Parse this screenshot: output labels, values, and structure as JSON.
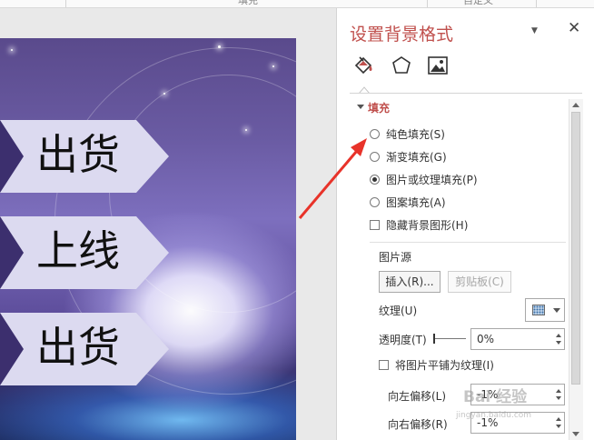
{
  "ribbon": {
    "left_text": "",
    "mid_text": "填充",
    "right_text": "自定义"
  },
  "slide": {
    "banners": [
      "出货",
      "上线",
      "出货"
    ]
  },
  "pane": {
    "title": "设置背景格式",
    "dropdown_glyph": "▼",
    "close_glyph": "✕",
    "tabs": [
      {
        "name": "fill-tab",
        "icon": "paint-bucket-icon",
        "active": true
      },
      {
        "name": "effects-tab",
        "icon": "pentagon-icon",
        "active": false
      },
      {
        "name": "picture-tab",
        "icon": "picture-icon",
        "active": false
      }
    ],
    "section": {
      "title": "填充",
      "expanded": true
    },
    "fill_options": [
      {
        "label": "纯色填充(S)",
        "checked": false
      },
      {
        "label": "渐变填充(G)",
        "checked": false
      },
      {
        "label": "图片或纹理填充(P)",
        "checked": true
      },
      {
        "label": "图案填充(A)",
        "checked": false
      }
    ],
    "hide_bg_graphics": {
      "label": "隐藏背景图形(H)",
      "checked": false
    },
    "picture_source": {
      "label": "图片源",
      "insert_label": "插入(R)...",
      "clipboard_label": "剪贴板(C)"
    },
    "texture": {
      "label": "纹理(U)"
    },
    "transparency": {
      "label": "透明度(T)",
      "value": "0%",
      "level": 0
    },
    "tile": {
      "label": "将图片平铺为纹理(I)",
      "checked": false
    },
    "offset_left": {
      "label": "向左偏移(L)",
      "value": "-1%"
    },
    "offset_right": {
      "label": "向右偏移(R)",
      "value": "-1%"
    }
  },
  "watermark": {
    "text": "Bai 经验",
    "sub": "jingyan.baidu.com"
  },
  "colors": {
    "accent": "#c0504d",
    "annotation": "#e8332a"
  }
}
